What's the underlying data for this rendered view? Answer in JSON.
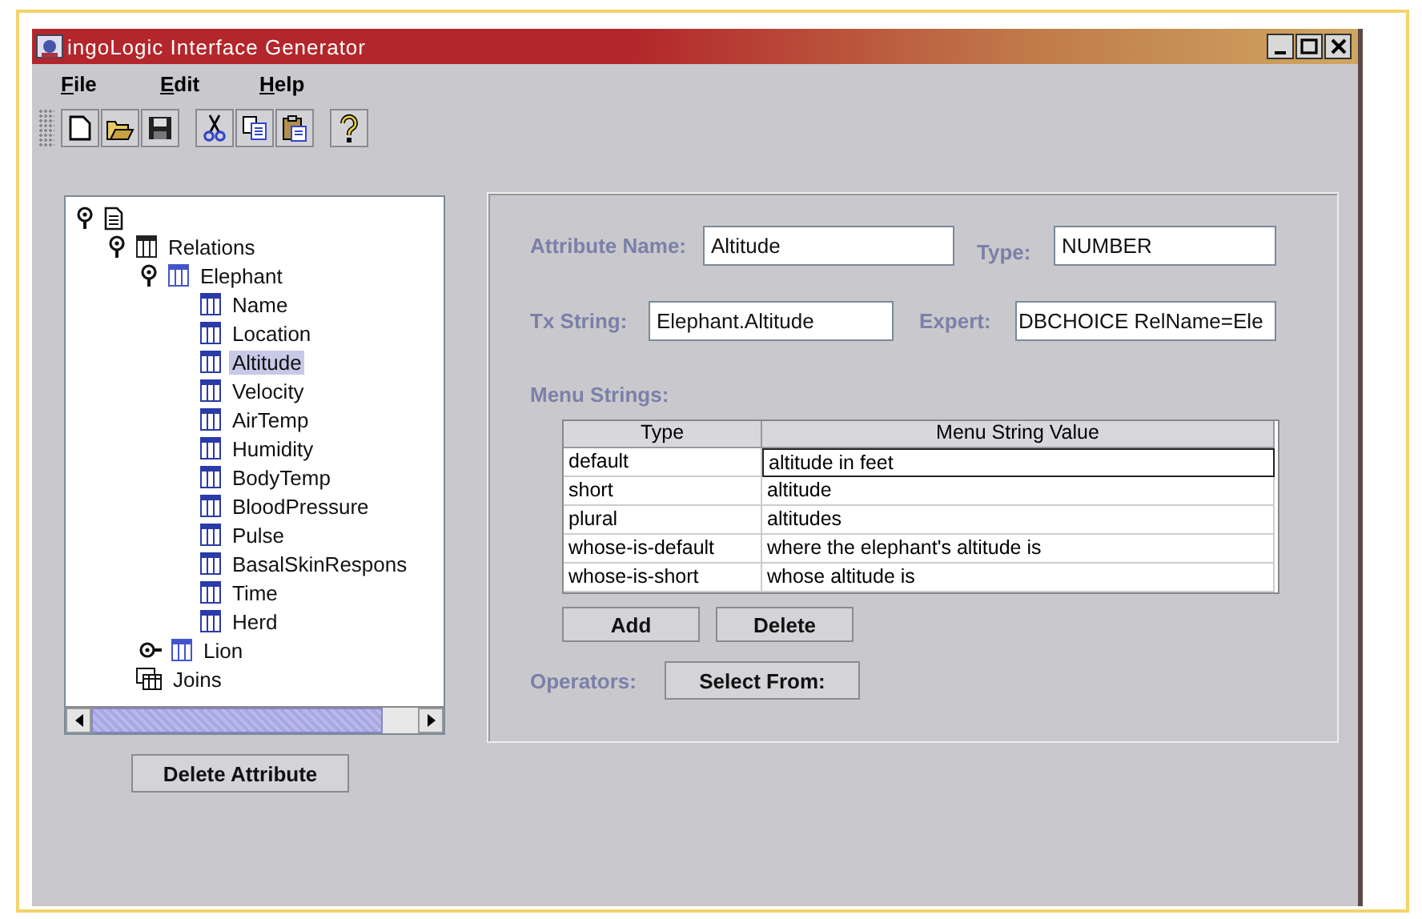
{
  "window": {
    "title": "ingoLogic Interface Generator"
  },
  "menu": [
    {
      "label": "File",
      "mnemonic_underlined": true
    },
    {
      "label": "Edit",
      "mnemonic_underlined": true
    },
    {
      "label": "Help",
      "mnemonic_underlined": true
    }
  ],
  "toolbar": [
    {
      "kind": "new"
    },
    {
      "kind": "open"
    },
    {
      "kind": "save"
    },
    {
      "kind": "separator"
    },
    {
      "kind": "cut"
    },
    {
      "kind": "copy"
    },
    {
      "kind": "paste"
    },
    {
      "kind": "separator"
    },
    {
      "kind": "help"
    }
  ],
  "tree": {
    "expanded": true,
    "children": [
      {
        "label": "Relations",
        "kind": "group",
        "expanded": true,
        "selected": false,
        "children": [
          {
            "label": "Elephant",
            "kind": "relation",
            "expanded": true,
            "selected": false,
            "children": [
              {
                "label": "Name",
                "kind": "attribute",
                "selected": false
              },
              {
                "label": "Location",
                "kind": "attribute",
                "selected": false
              },
              {
                "label": "Altitude",
                "kind": "attribute",
                "selected": true
              },
              {
                "label": "Velocity",
                "kind": "attribute",
                "selected": false
              },
              {
                "label": "AirTemp",
                "kind": "attribute",
                "selected": false
              },
              {
                "label": "Humidity",
                "kind": "attribute",
                "selected": false
              },
              {
                "label": "BodyTemp",
                "kind": "attribute",
                "selected": false
              },
              {
                "label": "BloodPressure",
                "kind": "attribute",
                "selected": false
              },
              {
                "label": "Pulse",
                "kind": "attribute",
                "selected": false
              },
              {
                "label": "BasalSkinRespons",
                "kind": "attribute",
                "selected": false
              },
              {
                "label": "Time",
                "kind": "attribute",
                "selected": false
              },
              {
                "label": "Herd",
                "kind": "attribute",
                "selected": false
              }
            ]
          },
          {
            "label": "Lion",
            "kind": "relation",
            "expanded": false,
            "selected": false
          }
        ]
      },
      {
        "label": "Joins",
        "kind": "joins",
        "selected": false
      }
    ]
  },
  "delete_attribute_button": "Delete Attribute",
  "form": {
    "attribute_name": {
      "label": "Attribute Name:",
      "value": "Altitude"
    },
    "type": {
      "label": "Type:",
      "value": "NUMBER"
    },
    "tx_string": {
      "label": "Tx String:",
      "value": "Elephant.Altitude"
    },
    "expert": {
      "label": "Expert:",
      "value": "DBCHOICE RelName=Ele"
    },
    "menu_strings_label": "Menu Strings:",
    "table": {
      "columns": [
        "Type",
        "Menu String Value"
      ],
      "rows": [
        {
          "type": "default",
          "value": "altitude in feet",
          "focused": true
        },
        {
          "type": "short",
          "value": "altitude",
          "focused": false
        },
        {
          "type": "plural",
          "value": "altitudes",
          "focused": false
        },
        {
          "type": "whose-is-default",
          "value": "where the elephant's altitude is",
          "focused": false
        },
        {
          "type": "whose-is-short",
          "value": "whose altitude is",
          "focused": false
        }
      ]
    },
    "add_button": "Add",
    "delete_button": "Delete",
    "operators_label": "Operators:",
    "select_from_button": "Select From:"
  }
}
